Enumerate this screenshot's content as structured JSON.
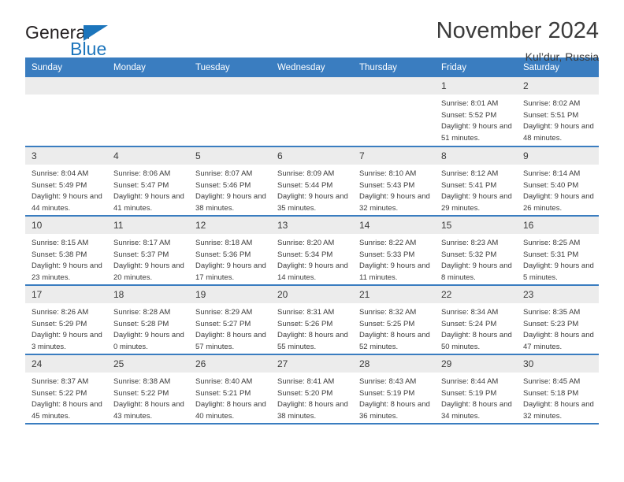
{
  "brand": {
    "word1": "General",
    "word2": "Blue",
    "triangle_color": "#1c75bc",
    "icon": "general-blue-logo"
  },
  "header": {
    "title": "November 2024",
    "location": "Kul’dur, Russia"
  },
  "theme": {
    "header_blue": "#3a7dc0",
    "daynum_gray": "#ececec",
    "text": "#3b3b3b",
    "brand_blue": "#1c75bc"
  },
  "calendar": {
    "weekday_headers": [
      "Sunday",
      "Monday",
      "Tuesday",
      "Wednesday",
      "Thursday",
      "Friday",
      "Saturday"
    ],
    "labels": {
      "sunrise": "Sunrise:",
      "sunset": "Sunset:",
      "daylight": "Daylight:"
    },
    "weeks": [
      [
        {
          "day": "",
          "empty": true
        },
        {
          "day": "",
          "empty": true
        },
        {
          "day": "",
          "empty": true
        },
        {
          "day": "",
          "empty": true
        },
        {
          "day": "",
          "empty": true
        },
        {
          "day": "1",
          "sunrise": "Sunrise: 8:01 AM",
          "sunset": "Sunset: 5:52 PM",
          "daylight": "Daylight: 9 hours and 51 minutes."
        },
        {
          "day": "2",
          "sunrise": "Sunrise: 8:02 AM",
          "sunset": "Sunset: 5:51 PM",
          "daylight": "Daylight: 9 hours and 48 minutes."
        }
      ],
      [
        {
          "day": "3",
          "sunrise": "Sunrise: 8:04 AM",
          "sunset": "Sunset: 5:49 PM",
          "daylight": "Daylight: 9 hours and 44 minutes."
        },
        {
          "day": "4",
          "sunrise": "Sunrise: 8:06 AM",
          "sunset": "Sunset: 5:47 PM",
          "daylight": "Daylight: 9 hours and 41 minutes."
        },
        {
          "day": "5",
          "sunrise": "Sunrise: 8:07 AM",
          "sunset": "Sunset: 5:46 PM",
          "daylight": "Daylight: 9 hours and 38 minutes."
        },
        {
          "day": "6",
          "sunrise": "Sunrise: 8:09 AM",
          "sunset": "Sunset: 5:44 PM",
          "daylight": "Daylight: 9 hours and 35 minutes."
        },
        {
          "day": "7",
          "sunrise": "Sunrise: 8:10 AM",
          "sunset": "Sunset: 5:43 PM",
          "daylight": "Daylight: 9 hours and 32 minutes."
        },
        {
          "day": "8",
          "sunrise": "Sunrise: 8:12 AM",
          "sunset": "Sunset: 5:41 PM",
          "daylight": "Daylight: 9 hours and 29 minutes."
        },
        {
          "day": "9",
          "sunrise": "Sunrise: 8:14 AM",
          "sunset": "Sunset: 5:40 PM",
          "daylight": "Daylight: 9 hours and 26 minutes."
        }
      ],
      [
        {
          "day": "10",
          "sunrise": "Sunrise: 8:15 AM",
          "sunset": "Sunset: 5:38 PM",
          "daylight": "Daylight: 9 hours and 23 minutes."
        },
        {
          "day": "11",
          "sunrise": "Sunrise: 8:17 AM",
          "sunset": "Sunset: 5:37 PM",
          "daylight": "Daylight: 9 hours and 20 minutes."
        },
        {
          "day": "12",
          "sunrise": "Sunrise: 8:18 AM",
          "sunset": "Sunset: 5:36 PM",
          "daylight": "Daylight: 9 hours and 17 minutes."
        },
        {
          "day": "13",
          "sunrise": "Sunrise: 8:20 AM",
          "sunset": "Sunset: 5:34 PM",
          "daylight": "Daylight: 9 hours and 14 minutes."
        },
        {
          "day": "14",
          "sunrise": "Sunrise: 8:22 AM",
          "sunset": "Sunset: 5:33 PM",
          "daylight": "Daylight: 9 hours and 11 minutes."
        },
        {
          "day": "15",
          "sunrise": "Sunrise: 8:23 AM",
          "sunset": "Sunset: 5:32 PM",
          "daylight": "Daylight: 9 hours and 8 minutes."
        },
        {
          "day": "16",
          "sunrise": "Sunrise: 8:25 AM",
          "sunset": "Sunset: 5:31 PM",
          "daylight": "Daylight: 9 hours and 5 minutes."
        }
      ],
      [
        {
          "day": "17",
          "sunrise": "Sunrise: 8:26 AM",
          "sunset": "Sunset: 5:29 PM",
          "daylight": "Daylight: 9 hours and 3 minutes."
        },
        {
          "day": "18",
          "sunrise": "Sunrise: 8:28 AM",
          "sunset": "Sunset: 5:28 PM",
          "daylight": "Daylight: 9 hours and 0 minutes."
        },
        {
          "day": "19",
          "sunrise": "Sunrise: 8:29 AM",
          "sunset": "Sunset: 5:27 PM",
          "daylight": "Daylight: 8 hours and 57 minutes."
        },
        {
          "day": "20",
          "sunrise": "Sunrise: 8:31 AM",
          "sunset": "Sunset: 5:26 PM",
          "daylight": "Daylight: 8 hours and 55 minutes."
        },
        {
          "day": "21",
          "sunrise": "Sunrise: 8:32 AM",
          "sunset": "Sunset: 5:25 PM",
          "daylight": "Daylight: 8 hours and 52 minutes."
        },
        {
          "day": "22",
          "sunrise": "Sunrise: 8:34 AM",
          "sunset": "Sunset: 5:24 PM",
          "daylight": "Daylight: 8 hours and 50 minutes."
        },
        {
          "day": "23",
          "sunrise": "Sunrise: 8:35 AM",
          "sunset": "Sunset: 5:23 PM",
          "daylight": "Daylight: 8 hours and 47 minutes."
        }
      ],
      [
        {
          "day": "24",
          "sunrise": "Sunrise: 8:37 AM",
          "sunset": "Sunset: 5:22 PM",
          "daylight": "Daylight: 8 hours and 45 minutes."
        },
        {
          "day": "25",
          "sunrise": "Sunrise: 8:38 AM",
          "sunset": "Sunset: 5:22 PM",
          "daylight": "Daylight: 8 hours and 43 minutes."
        },
        {
          "day": "26",
          "sunrise": "Sunrise: 8:40 AM",
          "sunset": "Sunset: 5:21 PM",
          "daylight": "Daylight: 8 hours and 40 minutes."
        },
        {
          "day": "27",
          "sunrise": "Sunrise: 8:41 AM",
          "sunset": "Sunset: 5:20 PM",
          "daylight": "Daylight: 8 hours and 38 minutes."
        },
        {
          "day": "28",
          "sunrise": "Sunrise: 8:43 AM",
          "sunset": "Sunset: 5:19 PM",
          "daylight": "Daylight: 8 hours and 36 minutes."
        },
        {
          "day": "29",
          "sunrise": "Sunrise: 8:44 AM",
          "sunset": "Sunset: 5:19 PM",
          "daylight": "Daylight: 8 hours and 34 minutes."
        },
        {
          "day": "30",
          "sunrise": "Sunrise: 8:45 AM",
          "sunset": "Sunset: 5:18 PM",
          "daylight": "Daylight: 8 hours and 32 minutes."
        }
      ]
    ]
  }
}
